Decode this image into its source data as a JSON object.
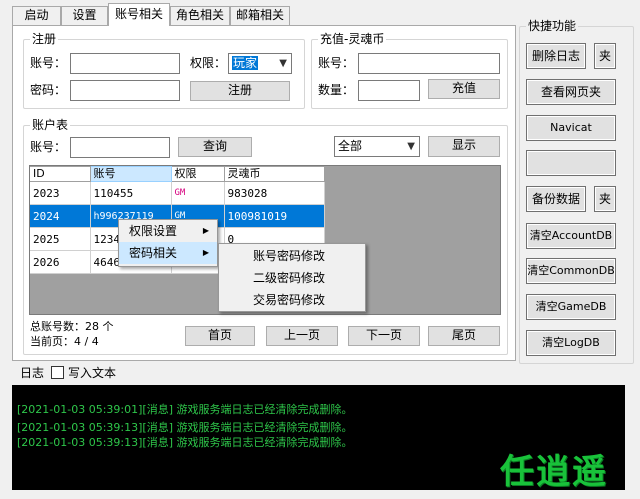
{
  "tabs": [
    {
      "label": "启动"
    },
    {
      "label": "设置"
    },
    {
      "label": "账号相关"
    },
    {
      "label": "角色相关"
    },
    {
      "label": "邮箱相关"
    }
  ],
  "register": {
    "title": "注册",
    "account_label": "账号：",
    "account_value": "",
    "password_label": "密码：",
    "password_value": "",
    "permission_label": "权限：",
    "permission_value": "玩家",
    "submit": "注册"
  },
  "recharge": {
    "title": "充值-灵魂币",
    "account_label": "账号：",
    "account_value": "",
    "amount_label": "数量：",
    "amount_value": "",
    "submit": "充值"
  },
  "accounts": {
    "title": "账户表",
    "account_label": "账号：",
    "search_value": "",
    "query_button": "查询",
    "filter_value": "全部",
    "show_button": "显示",
    "columns": [
      "ID",
      "账号",
      "权限",
      "灵魂币"
    ],
    "rows": [
      {
        "id": "2023",
        "account": "110455",
        "perm": "GM",
        "coin": "983028"
      },
      {
        "id": "2024",
        "account": "h996237119",
        "perm": "GM",
        "coin": "100981019"
      },
      {
        "id": "2025",
        "account": "12345",
        "perm": "",
        "coin": "0"
      },
      {
        "id": "2026",
        "account": "46460",
        "perm": "",
        "coin": ""
      }
    ],
    "total_label": "总账号数：",
    "total_value": "28",
    "total_unit": "个",
    "page_label": "当前页：",
    "page_value": "4 / 4",
    "first_page": "首页",
    "prev_page": "上一页",
    "next_page": "下一页",
    "last_page": "尾页"
  },
  "context_menu": {
    "items": [
      "权限设置",
      "密码相关"
    ],
    "submenu": [
      "账号密码修改",
      "二级密码修改",
      "交易密码修改"
    ]
  },
  "shortcuts": {
    "title": "快捷功能",
    "buttons": [
      "删除日志",
      "夹",
      "查看网页夹",
      "Navicat",
      "",
      "备份数据",
      "夹",
      "清空AccountDB",
      "清空CommonDB",
      "清空GameDB",
      "清空LogDB"
    ]
  },
  "log": {
    "title": "日志",
    "write_text_label": "写入文本",
    "lines": [
      "[2021-01-03 05:39:01][消息] 游戏服务端日志已经清除完成删除。",
      "[2021-01-03 05:39:13][消息] 游戏服务端日志已经清除完成删除。",
      "[2021-01-03 05:39:13][消息] 游戏服务端日志已经清除完成删除。"
    ]
  },
  "watermark": "任逍遥",
  "colors": {
    "selection": "#0078d7",
    "gm_text": "#d6007e",
    "log_text": "#2ec64a",
    "watermark": "#19c23a"
  }
}
